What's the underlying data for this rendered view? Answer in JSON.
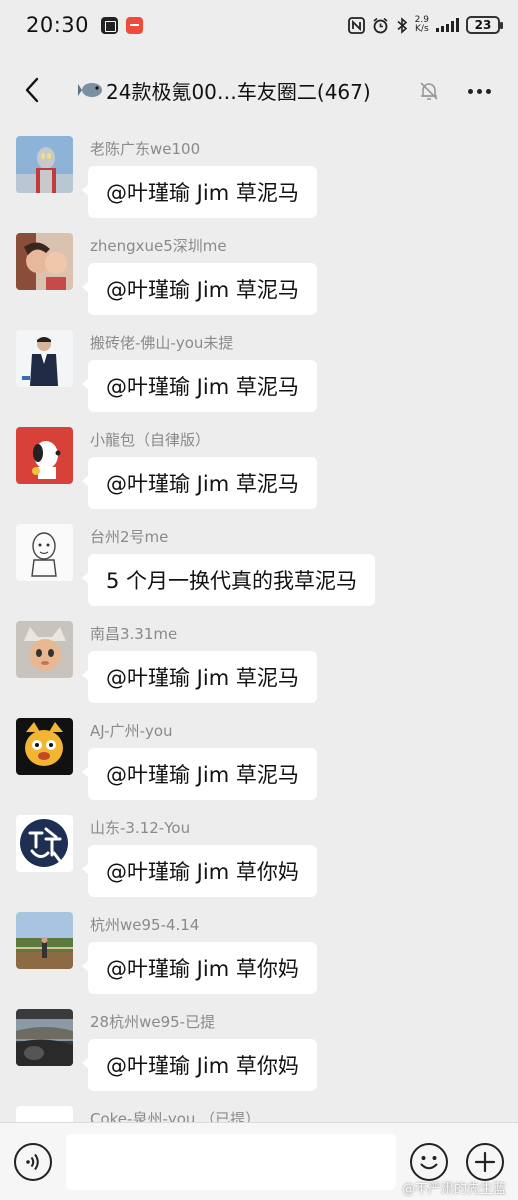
{
  "status_bar": {
    "time": "20:30",
    "net_speed_value": "2.9",
    "net_speed_unit": "K/s",
    "battery": "23",
    "icons": [
      "notification-app-icon",
      "red-app-icon",
      "nfc-icon",
      "alarm-icon",
      "bluetooth-icon",
      "signal-icon",
      "battery-icon"
    ]
  },
  "header": {
    "title": "24款极氪00…车友圈二(467)",
    "icons": [
      "back-arrow-icon",
      "fish-emoji-icon",
      "mute-bell-icon",
      "more-icon"
    ]
  },
  "messages": [
    {
      "sender": "老陈广东we100",
      "text": "@叶瑾瑜 Jim  草泥马",
      "avatar": "ultraman-avatar"
    },
    {
      "sender": "zhengxue5深圳me",
      "text": "@叶瑾瑜 Jim  草泥马",
      "avatar": "selfie-avatar"
    },
    {
      "sender": "搬砖佬-佛山-you未提",
      "text": "@叶瑾瑜 Jim  草泥马",
      "avatar": "suit-man-avatar"
    },
    {
      "sender": "小龍包（自律版）",
      "text": "@叶瑾瑜 Jim  草泥马",
      "avatar": "snoopy-avatar"
    },
    {
      "sender": "台州2号me",
      "text": "5 个月一换代真的我草泥马",
      "avatar": "sketch-avatar"
    },
    {
      "sender": "南昌3.31me",
      "text": "@叶瑾瑜 Jim  草泥马",
      "avatar": "cat-hat-avatar"
    },
    {
      "sender": "AJ-广州-you",
      "text": "@叶瑾瑜 Jim  草泥马",
      "avatar": "cartoon-dog-avatar"
    },
    {
      "sender": "山东-3.12-You",
      "text": "@叶瑾瑜 Jim  草你妈",
      "avatar": "calligraphy-avatar"
    },
    {
      "sender": "杭州we95-4.14",
      "text": "@叶瑾瑜 Jim  草你妈",
      "avatar": "outdoor-avatar"
    },
    {
      "sender": "28杭州we95-已提",
      "text": "@叶瑾瑜 Jim  草你妈",
      "avatar": "car-interior-avatar"
    },
    {
      "sender": "Coke-泉州-you （已提）",
      "text": "",
      "avatar": "white-avatar"
    }
  ],
  "input_bar": {
    "placeholder": "",
    "icons": [
      "voice-icon",
      "emoji-icon",
      "plus-icon"
    ]
  },
  "watermark": "@不严肃的先生蓝"
}
